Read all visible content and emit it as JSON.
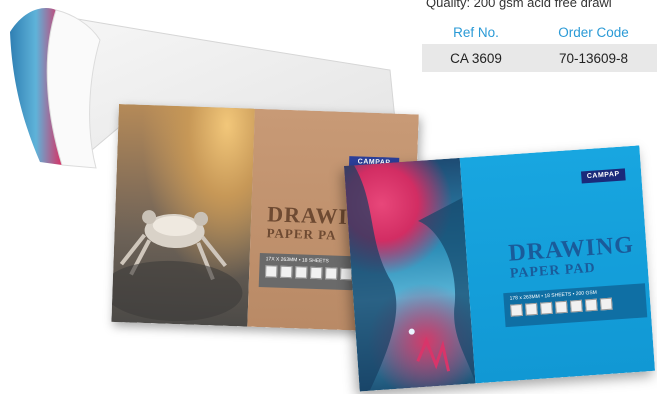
{
  "header": {
    "quality_text": "Quality: 200 gsm acid free drawi"
  },
  "spec_table": {
    "headers": [
      "Ref No.",
      "Order Code"
    ],
    "row": [
      "CA 3609",
      "70-13609-8"
    ]
  },
  "brown_pad": {
    "logo": "CAMPAP",
    "title": "DRAWI",
    "subtitle": "PAPER PA",
    "spec": "17X X 263MM • 18 SHEETS"
  },
  "blue_pad": {
    "logo": "CAMPAP",
    "title": "DRAWING",
    "subtitle": "PAPER PAD",
    "spec": "178 x 263MM • 18 SHEETS • 200 GSM"
  },
  "colors": {
    "header_blue": "#2a9ad6",
    "row_bg": "#e8e8e8",
    "blue_cover": "#18a6e0",
    "brown_cover": "#c89a76"
  }
}
